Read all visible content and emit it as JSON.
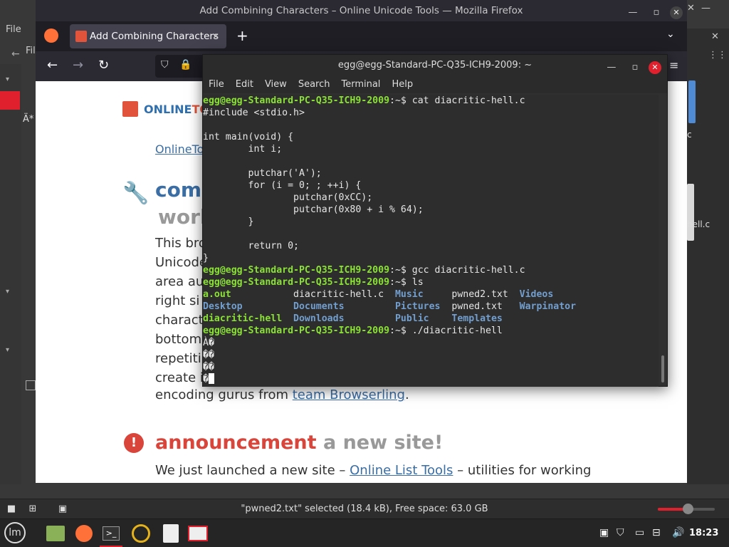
{
  "file_manager": {
    "menu_label": "File",
    "menu_label_2": "Fil",
    "status_text": "\"pwned2.txt\" selected (18.4 kB), Free space: 63.0 GB",
    "right_labels": [
      "c",
      "hell.c"
    ],
    "zoom_level": 0.52,
    "accent": "#e0202d"
  },
  "firefox": {
    "window_title": "Add Combining Characters – Online Unicode Tools — Mozilla Firefox",
    "tab_label": "Add Combining Characters",
    "tab_close": "✕",
    "new_tab": "+",
    "page": {
      "logo_text_a": "ONLINE",
      "logo_text_b": "TO",
      "breadcrumb": "OnlineTo",
      "title_line1": "comb",
      "title_line2": "work",
      "paragraph_lines": [
        "This bro",
        "Unicode",
        "area au",
        "right si",
        "charact",
        "bottom",
        "repetiti",
        "create i"
      ],
      "paragraph_last_prefix": "encoding gurus from ",
      "paragraph_last_link": "team Browserling",
      "paragraph_last_suffix": ".",
      "announcement_word": "announcement",
      "announcement_rest": "a new site!",
      "announcement_prefix": "We just launched a new site – ",
      "announcement_link": "Online List Tools",
      "announcement_suffix": " – utilities for working"
    }
  },
  "terminal": {
    "title": "egg@egg-Standard-PC-Q35-ICH9-2009: ~",
    "menu": [
      "File",
      "Edit",
      "View",
      "Search",
      "Terminal",
      "Help"
    ],
    "prompt": "egg@egg-Standard-PC-Q35-ICH9-2009",
    "prompt_suffix": ":~$ ",
    "commands": [
      "cat diacritic-hell.c",
      "gcc diacritic-hell.c",
      "ls",
      "./diacritic-hell"
    ],
    "source_lines": [
      "#include <stdio.h>",
      "",
      "int main(void) {",
      "        int i;",
      "",
      "        putchar('A');",
      "        for (i = 0; ; ++i) {",
      "                putchar(0xCC);",
      "                putchar(0x80 + i % 64);",
      "        }",
      "",
      "        return 0;",
      "}"
    ],
    "ls_rows": [
      [
        "a.out",
        "diacritic-hell.c",
        "Music",
        "pwned2.txt",
        "Videos"
      ],
      [
        "Desktop",
        "Documents",
        "Pictures",
        "pwned.txt",
        "Warpinator"
      ],
      [
        "diacritic-hell",
        "Downloads",
        "Public",
        "Templates",
        ""
      ]
    ],
    "output_lines": [
      "À�",
      "��",
      "��",
      "�"
    ],
    "prompt_color": "#8ae234",
    "dir_color": "#729fcf"
  },
  "taskbar": {
    "clock": "18:23",
    "apps": [
      "menu-icon",
      "file-manager-icon",
      "firefox-icon",
      "terminal-icon",
      "update-icon",
      "text-editor-icon",
      "screenshot-icon"
    ]
  }
}
